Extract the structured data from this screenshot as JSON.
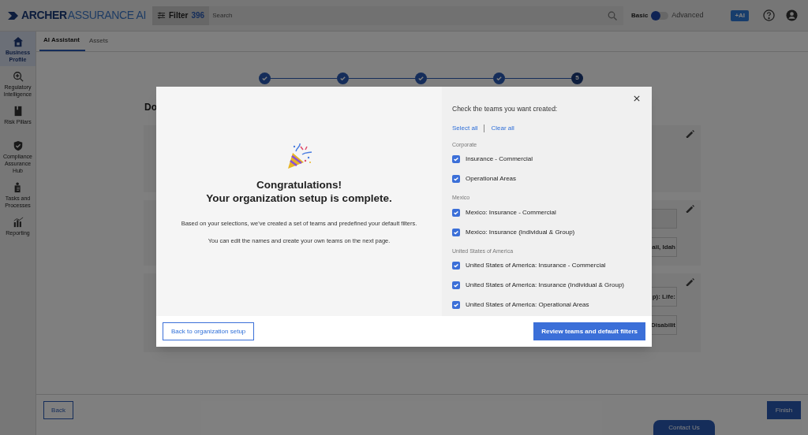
{
  "top_bar": {
    "logo_primary": "ARCHER",
    "logo_secondary": "ASSURANCE AI",
    "filter_label": "Filter",
    "filter_count": "396",
    "search_placeholder": "Search",
    "mode_toggle": {
      "left_label": "Basic",
      "right_label": "Advanced",
      "on": false
    },
    "ai_button": "+AI"
  },
  "sidebar": {
    "items": [
      {
        "label": "Business Profile",
        "kind": "home",
        "selected": true
      },
      {
        "label": "Regulatory Intelligence",
        "kind": "zoom",
        "selected": false
      },
      {
        "label": "Risk Pillars",
        "kind": "book",
        "selected": false
      },
      {
        "label": "Compliance Assurance Hub",
        "kind": "shield",
        "selected": false
      },
      {
        "label": "Tasks and Processes",
        "kind": "tasks",
        "selected": false
      },
      {
        "label": "Reporting",
        "kind": "chart",
        "selected": false
      }
    ]
  },
  "tabs": [
    {
      "label": "AI Assistant",
      "selected": true
    },
    {
      "label": "Assets",
      "selected": false
    }
  ],
  "stepper": [
    {
      "kind": "done"
    },
    {
      "kind": "done"
    },
    {
      "kind": "done"
    },
    {
      "kind": "done"
    },
    {
      "kind": "current",
      "label": "5"
    }
  ],
  "page_heading": "Do",
  "cards": [
    {
      "editable": true
    },
    {
      "editable": true,
      "fields": [
        {
          "kind": "empty"
        },
        {
          "kind": "text",
          "value": "aii, Idah"
        }
      ]
    },
    {
      "editable": true,
      "fields": [
        {
          "kind": "text",
          "value": "p): Life:"
        },
        {
          "kind": "text",
          "value": "Disabilit"
        }
      ]
    }
  ],
  "bottom_bar": {
    "back": "Back",
    "finish": "Finish",
    "contact": "Contact Us"
  },
  "modal": {
    "title_lines": [
      "Congratulations!",
      "Your organization setup is complete."
    ],
    "paragraphs": [
      "Based on your selections, we've created a set of teams and predefined your default filters.",
      "You can edit the names and create your own teams on the next page."
    ],
    "prompt": "Check the teams you want created:",
    "select_all": "Select all",
    "clear_all": "Clear all",
    "groups": [
      {
        "name": "Corporate",
        "teams": [
          {
            "label": "Insurance - Commercial",
            "checked": true
          },
          {
            "label": "Operational Areas",
            "checked": true
          }
        ]
      },
      {
        "name": "Mexico",
        "teams": [
          {
            "label": "Mexico: Insurance - Commercial",
            "checked": true
          },
          {
            "label": "Mexico: Insurance (Individual & Group)",
            "checked": true
          }
        ]
      },
      {
        "name": "United States of America",
        "teams": [
          {
            "label": "United States of America: Insurance - Commercial",
            "checked": true
          },
          {
            "label": "United States of America: Insurance (Individual & Group)",
            "checked": true
          },
          {
            "label": "United States of America: Operational Areas",
            "checked": true
          }
        ]
      }
    ],
    "secondary_button": "Back to organization setup",
    "primary_button": "Review teams and default filters"
  }
}
